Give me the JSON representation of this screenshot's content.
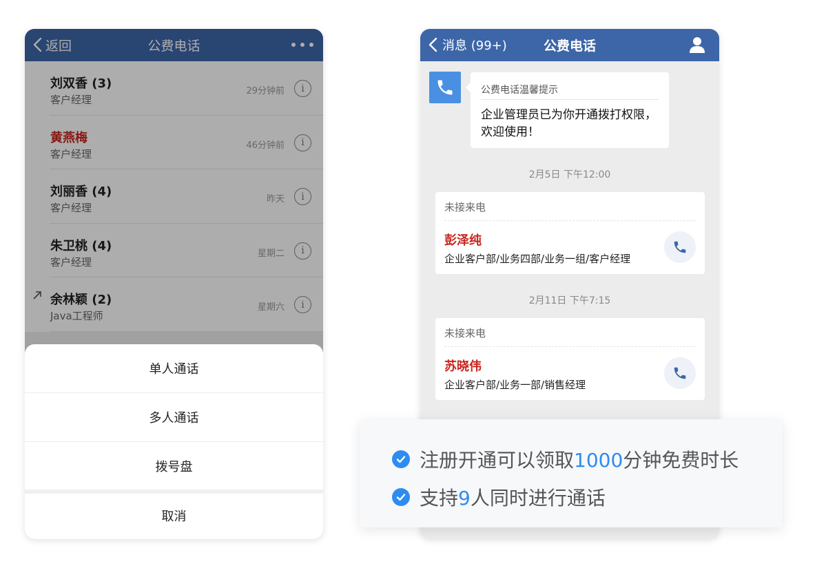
{
  "left_phone": {
    "header": {
      "back_label": "返回",
      "title": "公费电话"
    },
    "contacts": [
      {
        "name": "刘双香 (3)",
        "role": "客户经理",
        "time": "29分钟前",
        "highlight": false,
        "outgoing": false
      },
      {
        "name": "黄燕梅",
        "role": "客户经理",
        "time": "46分钟前",
        "highlight": true,
        "outgoing": false
      },
      {
        "name": "刘丽香 (4)",
        "role": "客户经理",
        "time": "昨天",
        "highlight": false,
        "outgoing": false
      },
      {
        "name": "朱卫桃 (4)",
        "role": "客户经理",
        "time": "星期二",
        "highlight": false,
        "outgoing": false
      },
      {
        "name": "余林颖 (2)",
        "role": "Java工程师",
        "time": "星期六",
        "highlight": false,
        "outgoing": true
      }
    ],
    "action_sheet": {
      "single_call": "单人通话",
      "multi_call": "多人通话",
      "dialpad": "拨号盘",
      "cancel": "取消"
    }
  },
  "right_phone": {
    "header": {
      "back_label": "消息 (99+)",
      "title": "公费电话"
    },
    "tip": {
      "title": "公费电话温馨提示",
      "body": "企业管理员已为你开通拨打权限，欢迎使用！"
    },
    "messages": [
      {
        "timestamp": "2月5日 下午12:00",
        "label": "未接来电",
        "name": "彭泽纯",
        "dept": "企业客户部/业务四部/业务一组/客户经理"
      },
      {
        "timestamp": "2月11日 下午7:15",
        "label": "未接来电",
        "name": "苏晓伟",
        "dept": "企业客户部/业务一部/销售经理"
      }
    ]
  },
  "features": {
    "line1": {
      "before": "注册开通可以领取",
      "highlight": "1000",
      "after": "分钟免费时长"
    },
    "line2": {
      "before": "支持",
      "highlight": "9",
      "after": "人同时进行通话"
    }
  },
  "colors": {
    "header_blue": "#3d66a8",
    "accent_red": "#c8261e",
    "accent_blue": "#2d8cf0",
    "tip_icon_blue": "#4a90e2"
  },
  "icons": [
    "chevron-left-icon",
    "more-icon",
    "info-icon",
    "outgoing-arrow-icon",
    "user-icon",
    "phone-icon",
    "check-icon"
  ]
}
